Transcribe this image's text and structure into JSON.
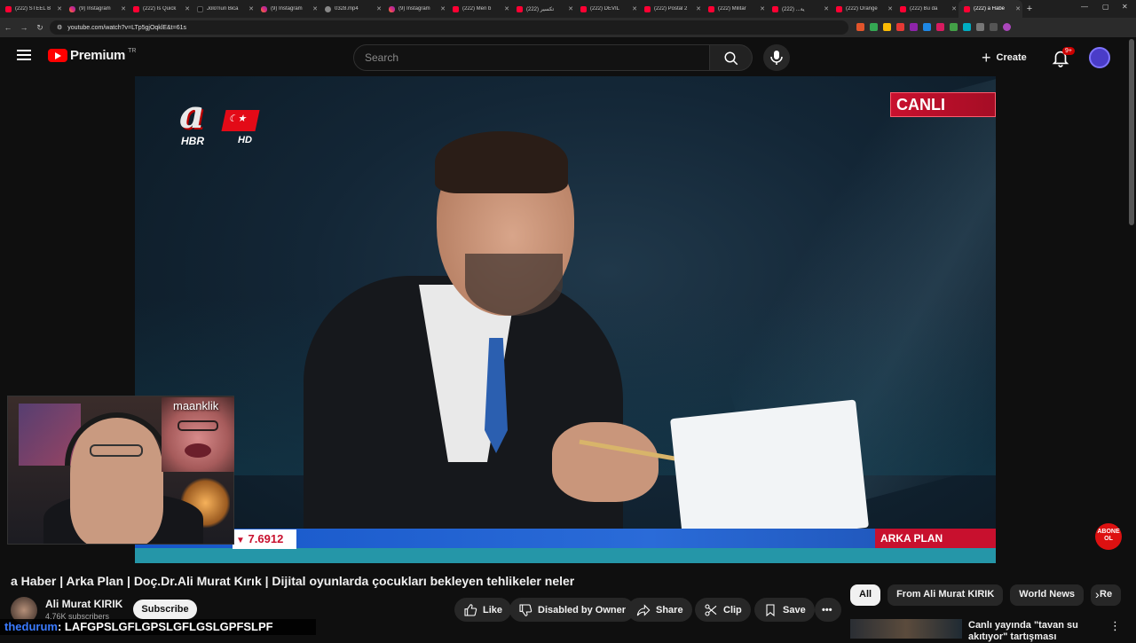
{
  "browser": {
    "tabs": [
      {
        "title": "(222) STEEL B",
        "icon": "youtube-icon"
      },
      {
        "title": "(9) Instagram",
        "icon": "instagram-icon"
      },
      {
        "title": "(222) Is Quick",
        "icon": "youtube-icon"
      },
      {
        "title": "Jolo'nun Bica",
        "icon": "tiktok-icon"
      },
      {
        "title": "(9) Instagram",
        "icon": "instagram-icon"
      },
      {
        "title": "0328.mp4",
        "icon": "globe-icon"
      },
      {
        "title": "(9) Instagram",
        "icon": "instagram-icon"
      },
      {
        "title": "(222) Men b",
        "icon": "youtube-icon"
      },
      {
        "title": "(222) تكسير",
        "icon": "youtube-icon"
      },
      {
        "title": "(222) DEVIL",
        "icon": "youtube-icon"
      },
      {
        "title": "(222) Postal 2",
        "icon": "youtube-icon"
      },
      {
        "title": "(222) Militar",
        "icon": "youtube-icon"
      },
      {
        "title": "(222) ...ية",
        "icon": "youtube-icon"
      },
      {
        "title": "(222) Orange",
        "icon": "youtube-icon"
      },
      {
        "title": "(222) Bu da",
        "icon": "youtube-icon"
      },
      {
        "title": "(222) a Habe",
        "icon": "youtube-icon",
        "active": true
      }
    ],
    "new_tab": "+",
    "url": "youtube.com/watch?v=LTp5gjOqklE&t=61s"
  },
  "header": {
    "logo_text": "Premium",
    "country": "TR",
    "search_placeholder": "Search",
    "create_label": "Create",
    "notification_badge": "9+"
  },
  "video": {
    "channel_logo": "a",
    "channel_logo_sub": "HBR",
    "channel_logo_hd": "HD",
    "live_label": "CANLI",
    "program_label": "ARKA PLAN",
    "ticker_value": "7.6912",
    "ticker_arrow": "▼",
    "subscribe_watermark": "ABONE OL",
    "facecam_name": "maanklik"
  },
  "details": {
    "title": "a Haber | Arka Plan | Doç.Dr.Ali Murat Kırık | Dijital oyunlarda çocukları bekleyen tehlikeler neler",
    "channel_name": "Ali Murat KIRIK",
    "subscribers": "4.76K subscribers",
    "subscribe_label": "Subscribe",
    "actions": {
      "like": "Like",
      "dislike": "Disabled by Owner",
      "share": "Share",
      "clip": "Clip",
      "save": "Save"
    }
  },
  "chips": [
    "All",
    "From Ali Murat KIRIK",
    "World News",
    "Re"
  ],
  "recommendation": {
    "title": "Canlı yayında \"tavan su akıtıyor\" tartışması"
  },
  "chat": {
    "user": "thedurum",
    "message": ": LAFGPSLGFLGPSLGFLGSLGPFSLPF"
  }
}
